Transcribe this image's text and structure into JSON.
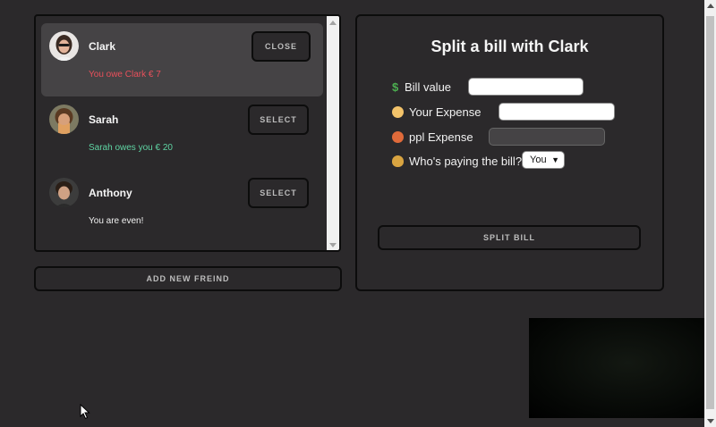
{
  "friends": [
    {
      "name": "Clark",
      "status": "You owe Clark € 7",
      "button_label": "Close",
      "selected": true
    },
    {
      "name": "Sarah",
      "status": "Sarah owes you € 20",
      "button_label": "Select",
      "selected": false
    },
    {
      "name": "Anthony",
      "status": "You are even!",
      "button_label": "Select",
      "selected": false
    }
  ],
  "add_friend_label": "Add New Freind",
  "split_form": {
    "title": "Split a bill with Clark",
    "bill_value_label": "Bill value",
    "bill_value": "",
    "your_expense_label": "Your Expense",
    "your_expense": "",
    "friend_expense_label": "ppl Expense",
    "friend_expense": "",
    "payer_label": "Who's paying the bill?",
    "payer_selected": "You",
    "submit_label": "Split Bill"
  },
  "colors": {
    "background": "#2b292b",
    "owe_red": "#e8505b",
    "owed_green": "#5fd4a3",
    "selected_row": "#454345"
  },
  "icons": {
    "bill_value": "dollar-sign-icon",
    "your_expense": "person-raising-hand-icon",
    "friend_expense": "person-gesturing-no-icon",
    "payer": "money-bag-icon"
  }
}
